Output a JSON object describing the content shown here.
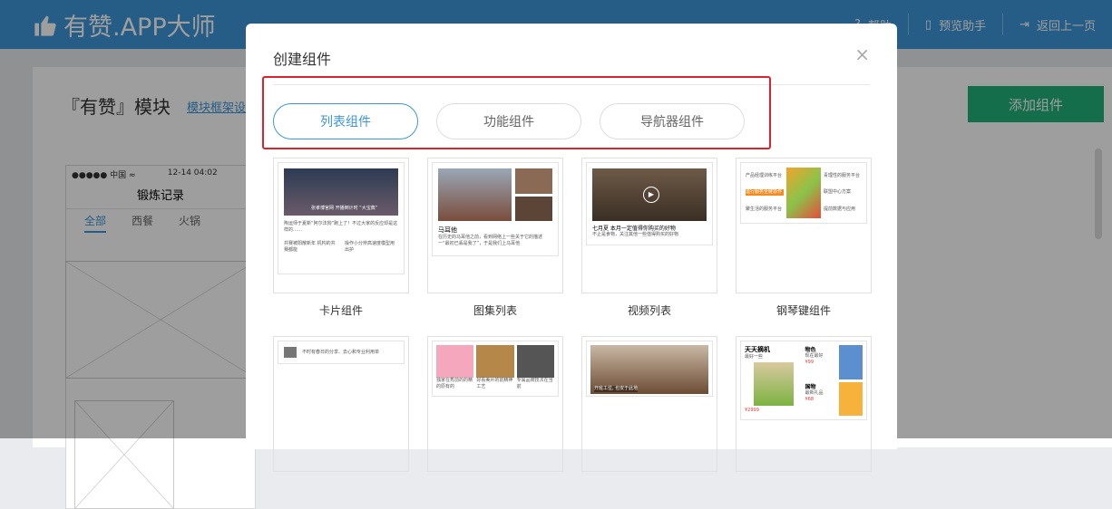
{
  "app": {
    "logo_text": "有赞.APP大师"
  },
  "topnav": [
    {
      "label": "帮助",
      "icon": "help-icon"
    },
    {
      "label": "预览助手",
      "icon": "phone-icon"
    },
    {
      "label": "返回上一页",
      "icon": "exit-icon"
    }
  ],
  "page": {
    "title": "『有赞』模块",
    "frame_link": "模块框架设置",
    "add_button": "添加组件"
  },
  "phone": {
    "status_left": "●●●●● 中国 ≈",
    "status_time": "12-14 04:02",
    "title": "锻炼记录",
    "tabs": [
      "全部",
      "西餐",
      "火锅"
    ]
  },
  "modal": {
    "title": "创建组件",
    "close": "×",
    "tabs": [
      {
        "label": "列表组件",
        "active": true
      },
      {
        "label": "功能组件"
      },
      {
        "label": "导航器组件"
      }
    ],
    "cards": [
      {
        "label": "卡片组件",
        "thumb_caption": "张孝博官网 开播倒计时 “大宝典”",
        "thumb_text1": "陶运师于夏新“阿尔法狗”跑上了！不过大家的反应却是这样的……",
        "thumb_text2a": "共赛被阳散新年 机构的共赛都能",
        "thumb_text2b": "操作小分辨高速度模型用出护"
      },
      {
        "label": "图集列表",
        "thumb_title": "马耳他",
        "thumb_text": "在历史的马耳他之前，看到网络上一些关于它的描述一“最初已丢是我了”，于是我们上马耳他"
      },
      {
        "label": "视频列表",
        "thumb_title": "七月夏 本月一定值得你购买的好物",
        "thumb_text": "不止是食物，关注其他一些值得购买的好物"
      },
      {
        "label": "钢琴键组件",
        "keys": [
          "产品经理训练平台",
          "运行服务全链协作",
          "聚生活的服务平台",
          "青理性的服务平台",
          "联盟中心方案",
          "提前数据与应用"
        ]
      },
      {
        "label": "",
        "thumb_text": "不时有春日的分享、去心和专业利用单"
      },
      {
        "label": "",
        "thumb_texts": [
          "独家在秀前的的精的原有的",
          "好看美片的前精神工艺",
          "专属品牌技法在当前"
        ]
      },
      {
        "label": "",
        "thumb_caption": "开班工位, 也安于此地"
      },
      {
        "label": "",
        "p1_title": "天天摘机",
        "p1_sub": "最好一些",
        "p1_price": "¥2999",
        "p2_title": "物色",
        "p2_sub": "现在最好",
        "p2_price": "¥99",
        "p3_title": "国物",
        "p3_sub": "最新礼品",
        "p3_price": "¥68"
      }
    ]
  },
  "colors": {
    "accent": "#3c97d9",
    "green": "#21b07a",
    "highlight": "#d9232f"
  }
}
